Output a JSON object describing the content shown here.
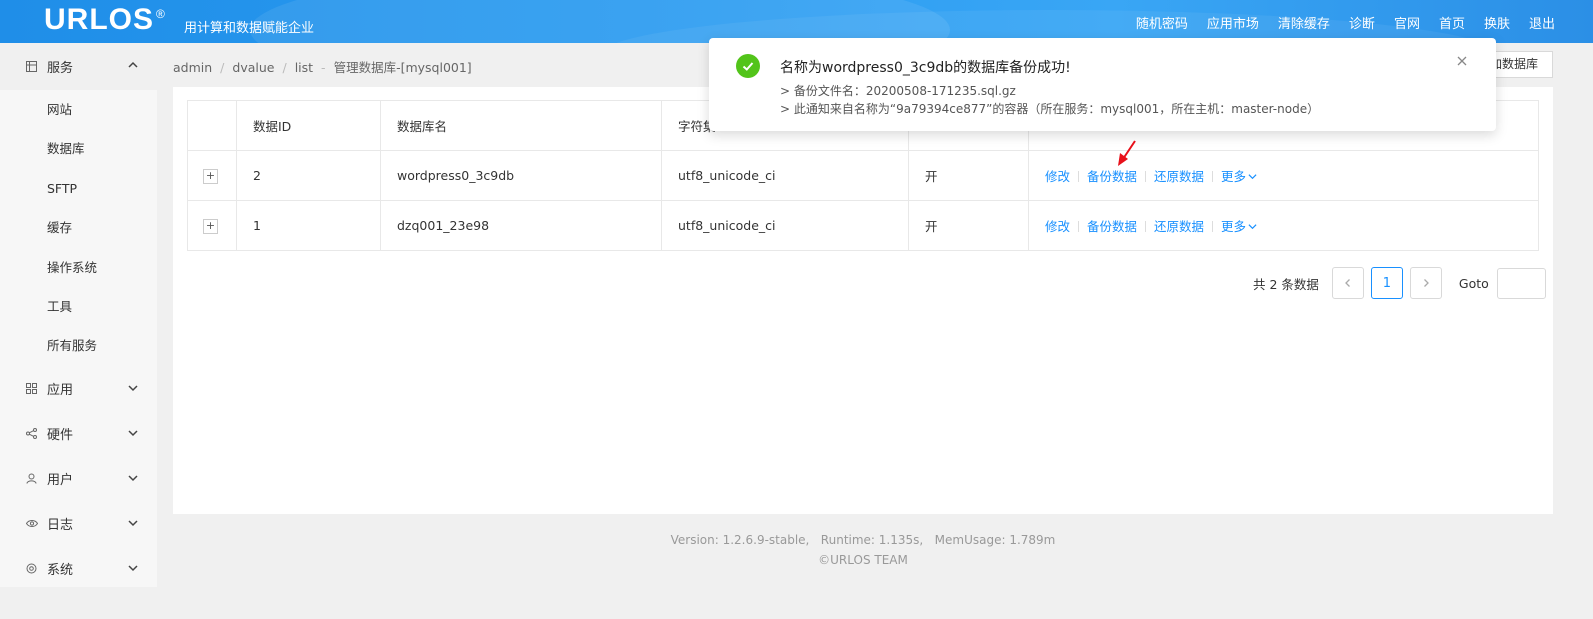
{
  "header": {
    "logo": "URLOS",
    "logo_mark": "®",
    "slogan": "用计算和数据赋能企业",
    "nav": [
      "随机密码",
      "应用市场",
      "清除缓存",
      "诊断",
      "官网",
      "首页",
      "换肤",
      "退出"
    ]
  },
  "sidebar": {
    "groups": [
      {
        "label": "服务",
        "icon": "grid-icon",
        "open": true,
        "items": [
          "网站",
          "数据库",
          "SFTP",
          "缓存",
          "操作系统",
          "工具",
          "所有服务"
        ]
      },
      {
        "label": "应用",
        "icon": "apps-icon"
      },
      {
        "label": "硬件",
        "icon": "share-icon"
      },
      {
        "label": "用户",
        "icon": "user-icon"
      },
      {
        "label": "日志",
        "icon": "eye-icon"
      },
      {
        "label": "系统",
        "icon": "gear-icon"
      }
    ]
  },
  "breadcrumb": [
    "admin",
    "dvalue",
    "list",
    "管理数据库-[mysql001]"
  ],
  "add_button": "加数据库",
  "table": {
    "headers": [
      "",
      "数据ID",
      "数据库名",
      "字符集",
      "",
      ""
    ],
    "rows": [
      {
        "id": "2",
        "name": "wordpress0_3c9db",
        "charset": "utf8_unicode_ci",
        "status": "开"
      },
      {
        "id": "1",
        "name": "dzq001_23e98",
        "charset": "utf8_unicode_ci",
        "status": "开"
      }
    ],
    "actions": [
      "修改",
      "备份数据",
      "还原数据",
      "更多"
    ]
  },
  "pagination": {
    "total": "共 2 条数据",
    "current": "1",
    "goto": "Goto"
  },
  "footer": {
    "version": "Version: 1.2.6.9-stable,   Runtime: 1.135s,   MemUsage: 1.789m",
    "copyright": "©URLOS TEAM"
  },
  "notification": {
    "title": "名称为wordpress0_3c9db的数据库备份成功!",
    "line1": "> 备份文件名：20200508-171235.sql.gz",
    "line2": "> 此通知来自名称为“9a79394ce877”的容器（所在服务：mysql001，所在主机：master-node）"
  },
  "colors": {
    "accent": "#1890ff",
    "success": "#52c41a",
    "header": "#2a9bf0",
    "arrow": "#e8101a"
  }
}
